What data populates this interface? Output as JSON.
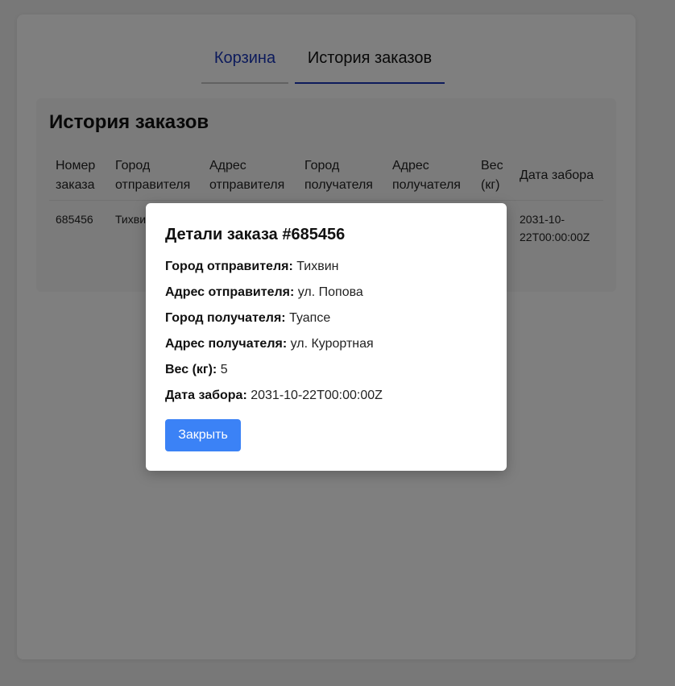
{
  "tabs": {
    "cart": "Корзина",
    "history": "История заказов"
  },
  "history": {
    "title": "История заказов",
    "columns": {
      "order_number": [
        "Номер",
        "заказа"
      ],
      "sender_city": [
        "Город",
        "отправителя"
      ],
      "sender_address": [
        "Адрес",
        "отправителя"
      ],
      "recipient_city": [
        "Город",
        "получателя"
      ],
      "recipient_address": [
        "Адрес",
        "получателя"
      ],
      "weight": [
        "Вес",
        "(кг)"
      ],
      "pickup_date": "Дата забора"
    },
    "rows": [
      {
        "order_number": "685456",
        "sender_city": "Тихвин",
        "pickup_date": [
          "2031-10-",
          "22T00:00:00Z"
        ]
      }
    ]
  },
  "modal": {
    "title": "Детали заказа #685456",
    "sender_city_label": "Город отправителя:",
    "sender_city_value": "Тихвин",
    "sender_address_label": "Адрес отправителя:",
    "sender_address_value": "ул. Попова",
    "recipient_city_label": "Город получателя:",
    "recipient_city_value": "Туапсе",
    "recipient_address_label": "Адрес получателя:",
    "recipient_address_value": "ул. Курортная",
    "weight_label": "Вес (кг):",
    "weight_value": "5",
    "pickup_date_label": "Дата забора:",
    "pickup_date_value": "2031-10-22T00:00:00Z",
    "close_label": "Закрыть"
  },
  "colors": {
    "accent": "#1a37b8",
    "button": "#3b82f6",
    "overlay": "rgba(0,0,0,0.5)"
  }
}
